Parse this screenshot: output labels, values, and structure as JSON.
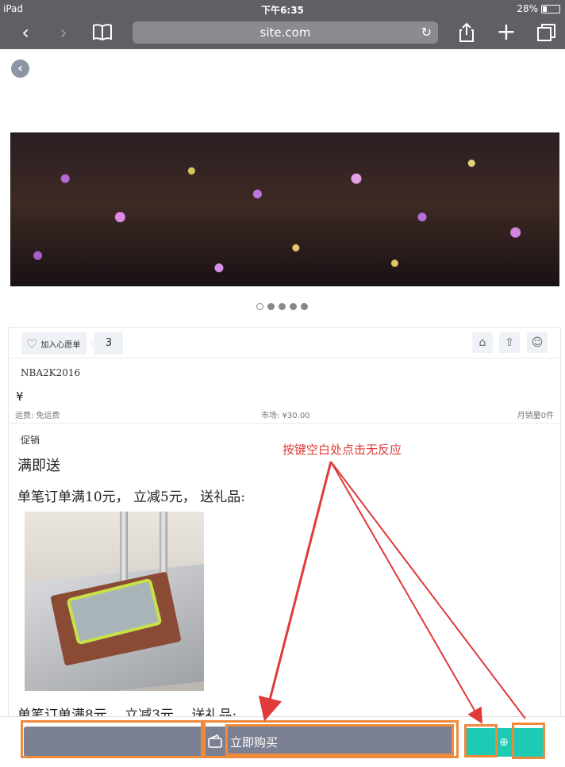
{
  "status_bar": {
    "device": "iPad",
    "time": "下午6:35",
    "battery": "28%"
  },
  "browser": {
    "url": "site.com"
  },
  "wish": {
    "label": "加入心愿单",
    "count": "3"
  },
  "product": {
    "name": "NBA2K2016",
    "price_symbol": "¥",
    "shipping": "运费: 免运费",
    "market_price": "市场: ¥30.00",
    "monthly_sales": "月销量0件"
  },
  "promotion": {
    "label": "促销",
    "title": "满即送",
    "line1": "单笔订单满10元， 立减5元， 送礼品:",
    "line2": "单笔订单满8元， 立减3元， 送礼品:"
  },
  "bottom": {
    "buy_label": "立即购买"
  },
  "annotation": {
    "text": "按键空白处点击无反应",
    "color": "#e03a3a"
  },
  "colors": {
    "accent_teal": "#1dcbb4",
    "button_gray": "#7b8192",
    "highlight_orange": "#f08a3a"
  },
  "carousel": {
    "total": 5,
    "active_index": 0
  }
}
